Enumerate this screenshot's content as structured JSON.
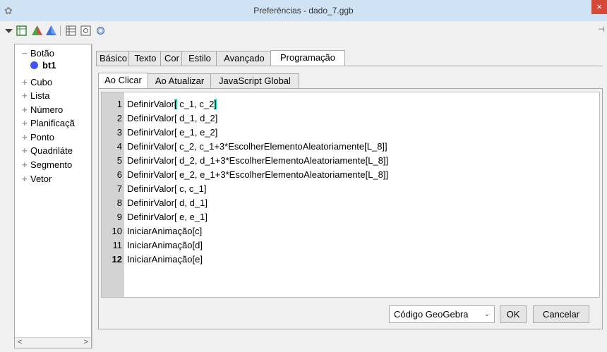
{
  "window": {
    "title": "Preferências - dado_7.ggb",
    "close_glyph": "×"
  },
  "toolbar": {
    "icons": [
      "dropdown-arrow-icon",
      "graphics-view-icon",
      "3d-pyramid-icon",
      "3d-blue-pyramid-icon",
      "spreadsheet-icon",
      "properties-icon",
      "settings-gear-icon",
      "pin-icon"
    ]
  },
  "tree": {
    "items": [
      {
        "label": "Botão",
        "expanded": true
      },
      {
        "label": "Cubo"
      },
      {
        "label": "Lista"
      },
      {
        "label": "Número"
      },
      {
        "label": "Planificaçã"
      },
      {
        "label": "Ponto"
      },
      {
        "label": "Quadriláte"
      },
      {
        "label": "Segmento"
      },
      {
        "label": "Vetor"
      }
    ],
    "selected_child": "bt1",
    "scroll_left": "<",
    "scroll_right": ">"
  },
  "tabs": [
    "Básico",
    "Texto",
    "Cor",
    "Estilo",
    "Avançado",
    "Programação"
  ],
  "active_tab": "Programação",
  "subtabs": [
    "Ao Clicar",
    "Ao Atualizar",
    "JavaScript Global"
  ],
  "active_subtab": "Ao Clicar",
  "script": {
    "lines": [
      {
        "n": "1",
        "pre": "DefinirValor",
        "hl1": "[",
        "mid": " c_1, c_2",
        "hl2": "]",
        "post": ""
      },
      {
        "n": "2",
        "text": "DefinirValor[ d_1, d_2]"
      },
      {
        "n": "3",
        "text": "DefinirValor[ e_1, e_2]"
      },
      {
        "n": "4",
        "text": "DefinirValor[ c_2, c_1+3*EscolherElementoAleatoriamente[L_8]]"
      },
      {
        "n": "5",
        "text": "DefinirValor[ d_2, d_1+3*EscolherElementoAleatoriamente[L_8]]"
      },
      {
        "n": "6",
        "text": "DefinirValor[ e_2, e_1+3*EscolherElementoAleatoriamente[L_8]]"
      },
      {
        "n": "7",
        "text": "DefinirValor[ c, c_1]"
      },
      {
        "n": "8",
        "text": "DefinirValor[ d, d_1]"
      },
      {
        "n": "9",
        "text": "DefinirValor[ e, e_1]"
      },
      {
        "n": "10",
        "text": "IniciarAnimação[c]"
      },
      {
        "n": "11",
        "text": "IniciarAnimação[d]"
      },
      {
        "n": "12",
        "text": "IniciarAnimação[e]"
      }
    ]
  },
  "footer": {
    "language_select": "Código GeoGebra",
    "ok": "OK",
    "cancel": "Cancelar"
  },
  "colors": {
    "titlebar": "#cfe3f5",
    "close": "#d44a3a",
    "selection_highlight": "#3ee0c8",
    "point_blue": "#3c55ff"
  }
}
